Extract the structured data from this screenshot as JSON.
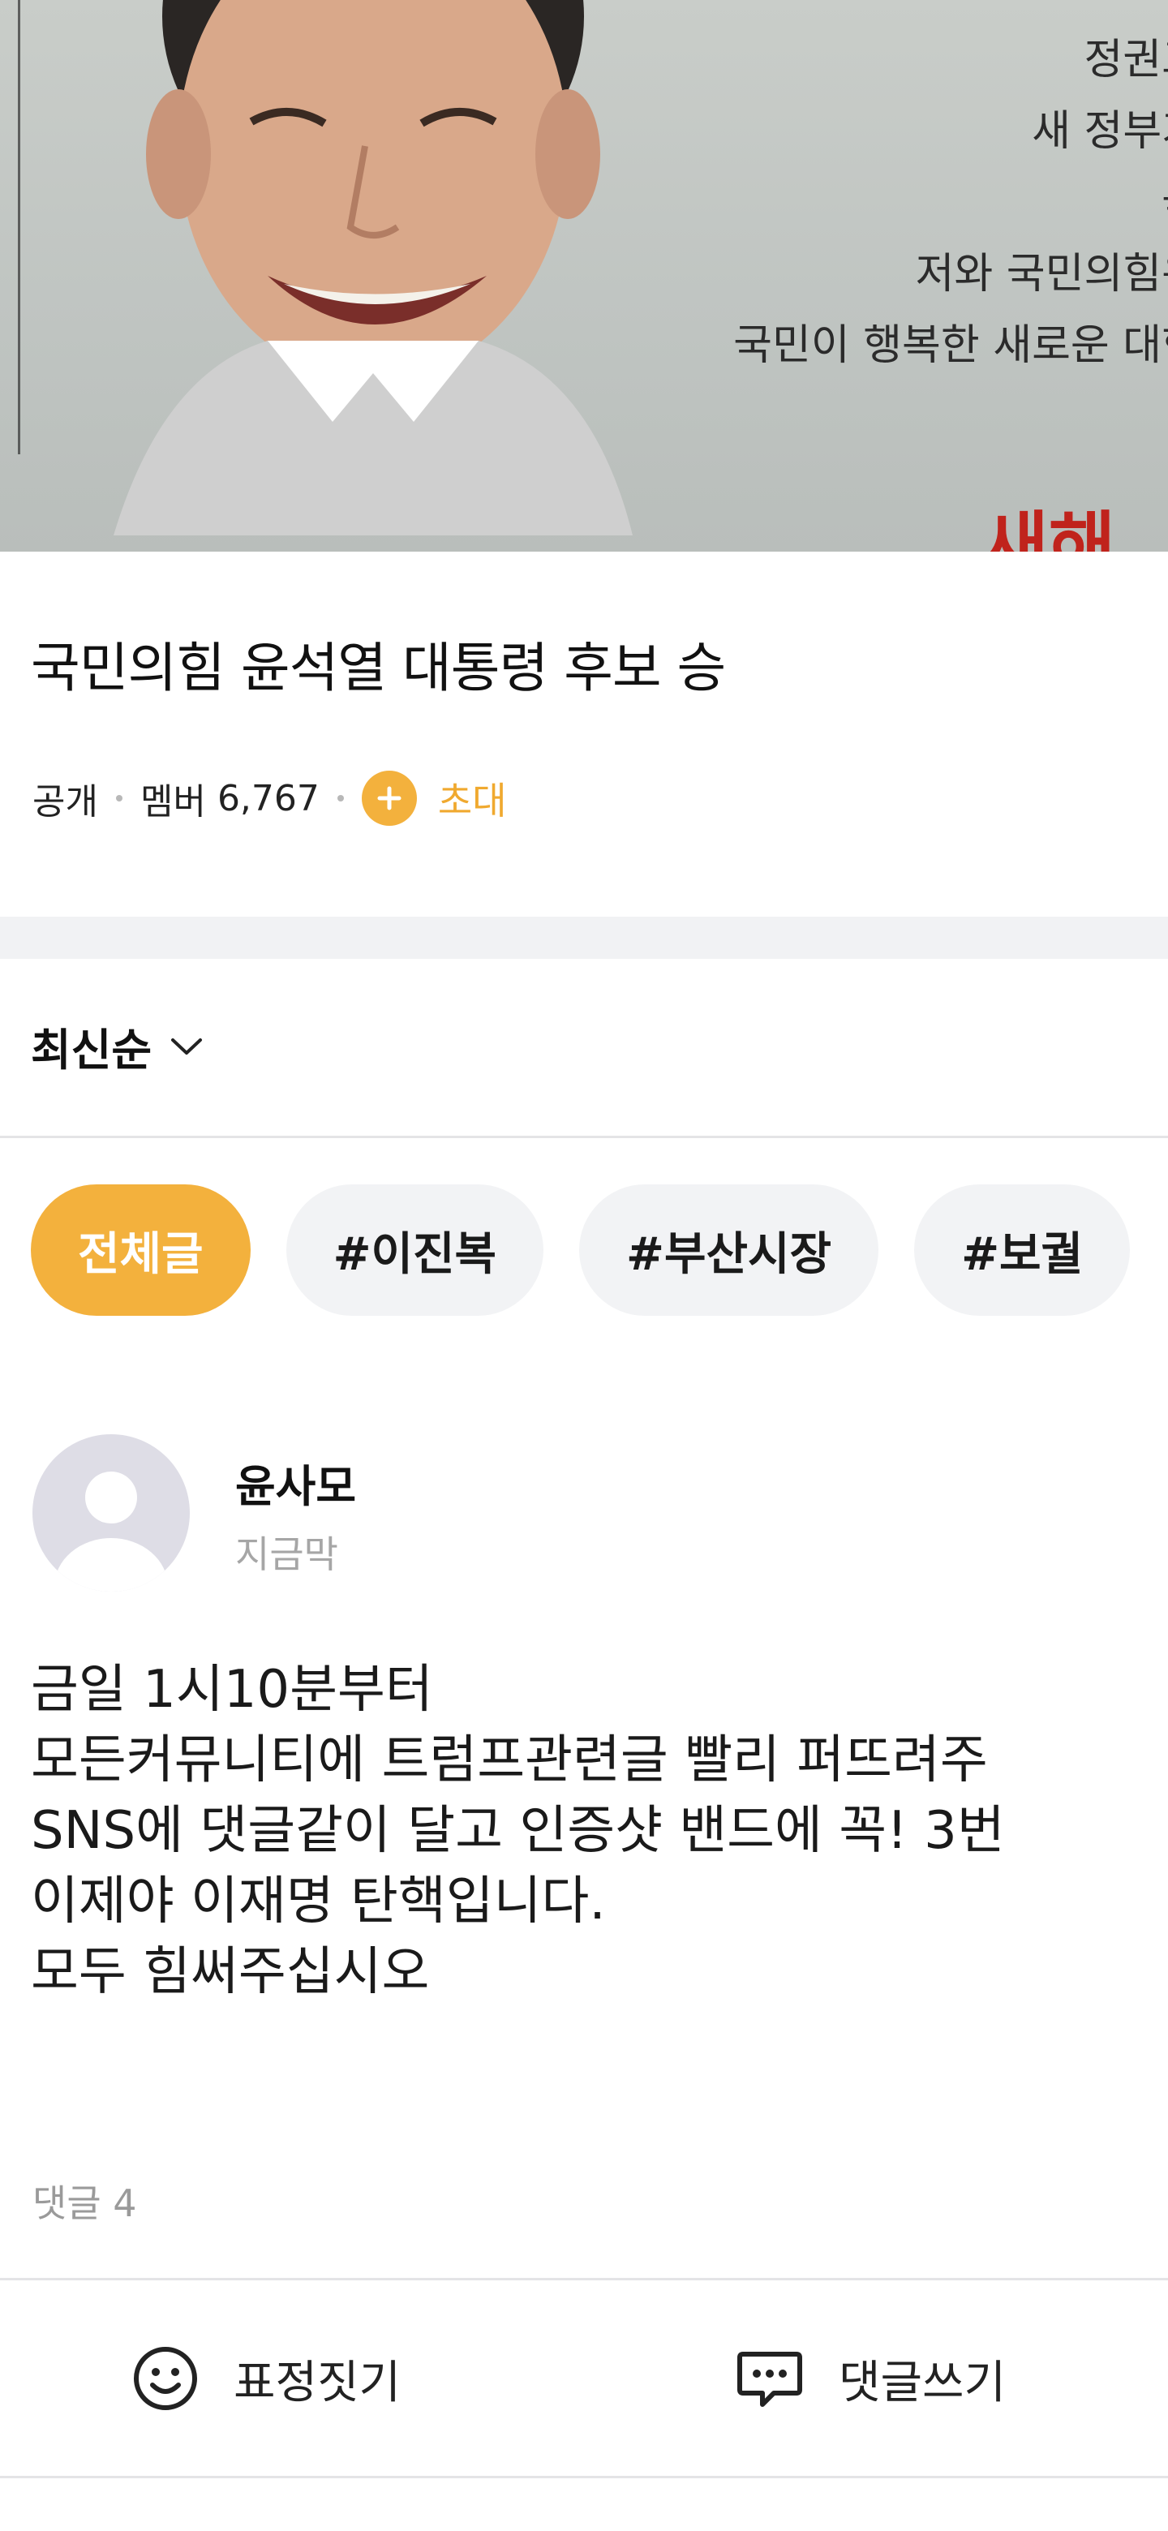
{
  "cover": {
    "text_lines": [
      "정권교",
      "새 정부가",
      "국",
      "저와 국민의힘은",
      "국민이 행복한 새로운 대한"
    ],
    "red_text": "새해"
  },
  "group": {
    "title": "국민의힘 윤석열 대통령 후보 승",
    "visibility": "공개",
    "members_label": "멤버",
    "member_count": "6,767",
    "invite_label": "초대"
  },
  "sort": {
    "label": "최신순"
  },
  "chips": [
    "전체글",
    "#이진복",
    "#부산시장",
    "#보궐"
  ],
  "post": {
    "author": "윤사모",
    "time": "지금막",
    "body_lines": [
      "금일 1시10분부터",
      "모든커뮤니티에 트럼프관련글 빨리 퍼뜨려주",
      "SNS에 댓글같이 달고 인증샷 밴드에 꼭! 3번",
      "이제야 이재명 탄핵입니다.",
      "모두 힘써주십시오"
    ],
    "comment_count_label": "댓글 4"
  },
  "actions": {
    "react_label": "표정짓기",
    "comment_label": "댓글쓰기"
  },
  "colors": {
    "accent": "#f3b13d",
    "chip_bg": "#f2f3f5",
    "divider": "#e4e4e6"
  }
}
